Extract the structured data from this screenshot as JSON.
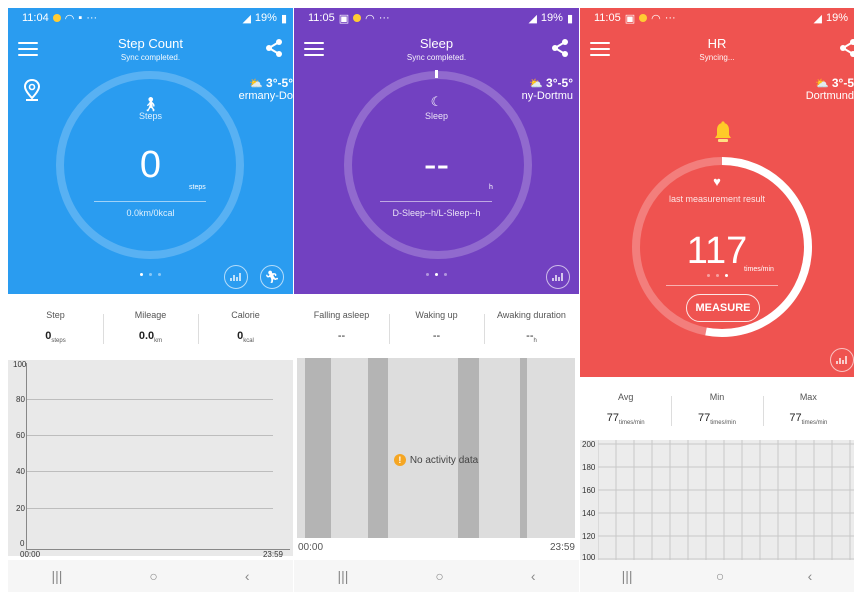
{
  "colors": {
    "step": "#2a9cf0",
    "sleep": "#7241c1",
    "hr": "#ef5350"
  },
  "step": {
    "status_time": "11:04",
    "status_right": "19%",
    "title": "Step Count",
    "subtitle": "Sync completed.",
    "weather_temp": "3°-5°",
    "weather_loc": "ermany-Do",
    "label": "Steps",
    "value": "0",
    "unit": "steps",
    "sub": "0.0km/0kcal",
    "stats": [
      {
        "label": "Step",
        "value": "0",
        "unit": "steps"
      },
      {
        "label": "Mileage",
        "value": "0.0",
        "unit": "km"
      },
      {
        "label": "Calorie",
        "value": "0",
        "unit": "kcal"
      }
    ],
    "y_ticks": [
      "100",
      "80",
      "60",
      "40",
      "20",
      "0"
    ],
    "x_start": "00:00",
    "x_end": "23:59"
  },
  "sleep": {
    "status_time": "11:05",
    "status_right": "19%",
    "title": "Sleep",
    "subtitle": "Sync completed.",
    "weather_temp": "3°-5°",
    "weather_loc": "ny-Dortmu",
    "label": "Sleep",
    "value": "--",
    "unit": "h",
    "sub": "D-Sleep--h/L-Sleep--h",
    "stats": [
      {
        "label": "Falling asleep",
        "value": "--",
        "unit": ""
      },
      {
        "label": "Waking up",
        "value": "--",
        "unit": ""
      },
      {
        "label": "Awaking duration",
        "value": "--",
        "unit": "h"
      }
    ],
    "no_data": "No activity data",
    "x_start": "00:00",
    "x_end": "23:59"
  },
  "hr": {
    "status_time": "11:05",
    "status_right": "19%",
    "title": "HR",
    "subtitle": "Syncing...",
    "weather_temp": "3°-5",
    "weather_loc": "Dortmund",
    "label": "last measurement result",
    "value": "117",
    "unit": "times/min",
    "button": "MEASURE",
    "stats": [
      {
        "label": "Avg",
        "value": "77",
        "unit": "times/min"
      },
      {
        "label": "Min",
        "value": "77",
        "unit": "times/min"
      },
      {
        "label": "Max",
        "value": "77",
        "unit": "times/min"
      }
    ],
    "y_ticks": [
      "200",
      "180",
      "160",
      "140",
      "120",
      "100"
    ]
  },
  "nav": {
    "recent": "|||",
    "home": "○",
    "back": "‹"
  }
}
